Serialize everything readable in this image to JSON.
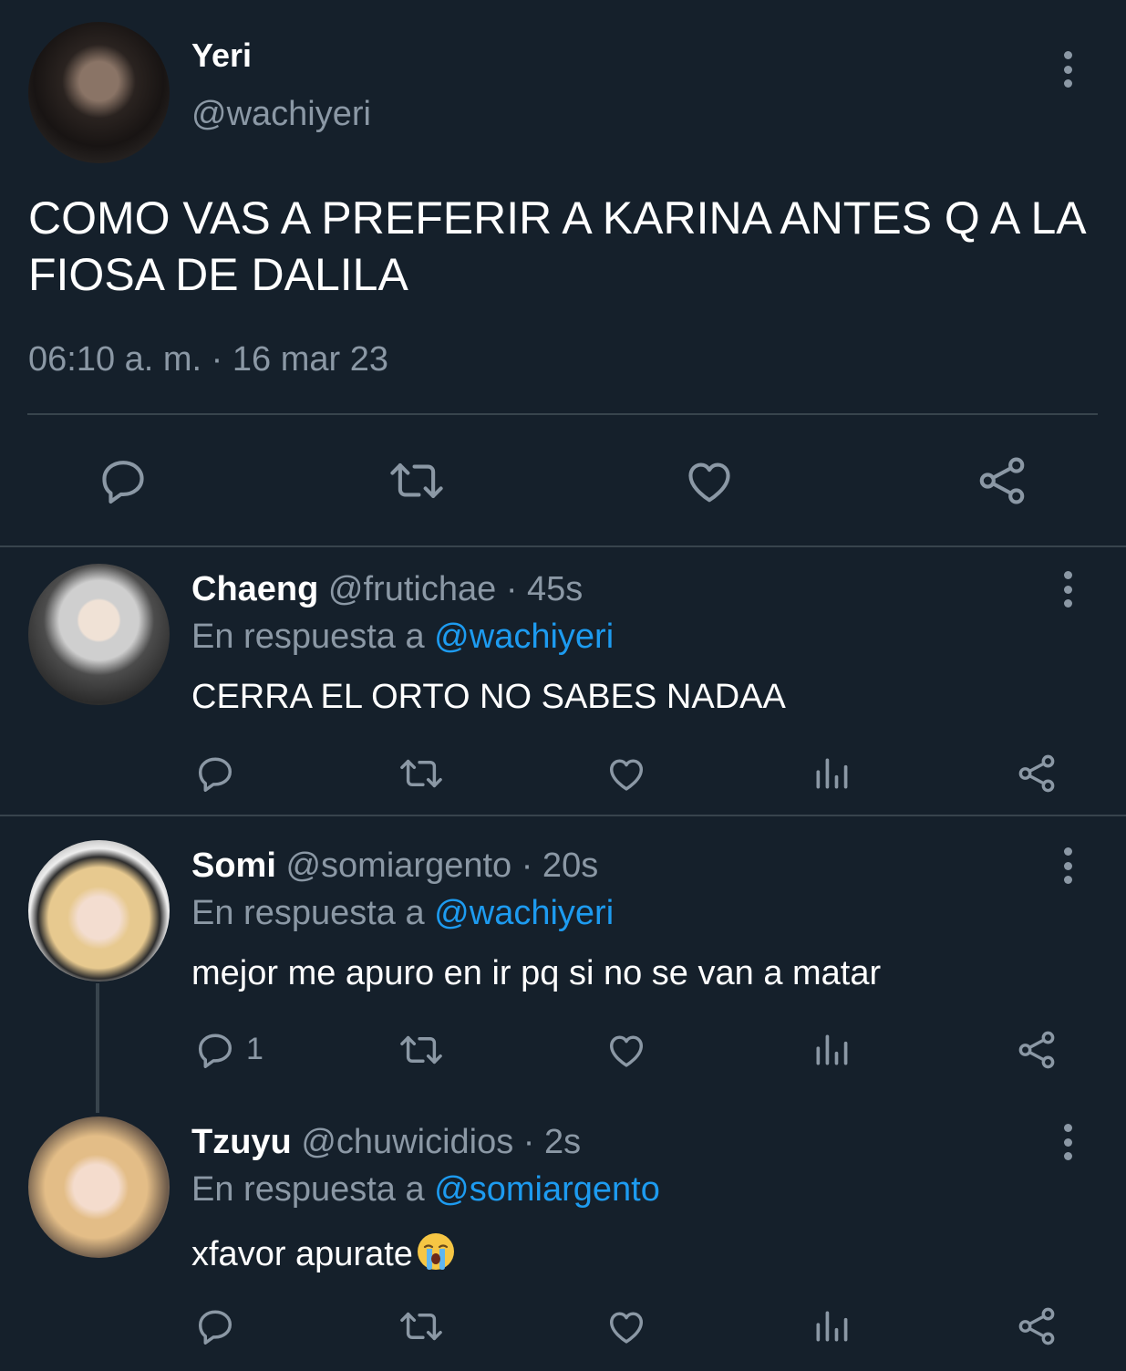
{
  "main_tweet": {
    "name": "Yeri",
    "handle": "@wachiyeri",
    "text": "COMO VAS A PREFERIR A KARINA ANTES Q A LA FIOSA DE DALILA",
    "timestamp": "06:10 a. m. · 16 mar 23",
    "actions": [
      "reply-icon",
      "retweet-icon",
      "like-icon",
      "share-icon"
    ]
  },
  "replies": [
    {
      "name": "Chaeng",
      "handle": "@frutichae",
      "time": "· 45s",
      "reply_prefix": "En respuesta a",
      "reply_to": "@wachiyeri",
      "text": "CERRA EL ORTO NO SABES NADAA",
      "reply_count": ""
    },
    {
      "name": "Somi",
      "handle": "@somiargento",
      "time": "· 20s",
      "reply_prefix": "En respuesta a",
      "reply_to": "@wachiyeri",
      "text": "mejor me apuro en ir pq si no se van a matar",
      "reply_count": "1"
    },
    {
      "name": "Tzuyu",
      "handle": "@chuwicidios",
      "time": "· 2s",
      "reply_prefix": "En respuesta a",
      "reply_to": "@somiargento",
      "text": "xfavor apurate",
      "emoji": "loudly-crying-face",
      "reply_count": ""
    }
  ],
  "colors": {
    "background": "#15202b",
    "text": "#ffffff",
    "muted": "#8b98a5",
    "link": "#1d9bf0",
    "divider": "#38444d"
  }
}
